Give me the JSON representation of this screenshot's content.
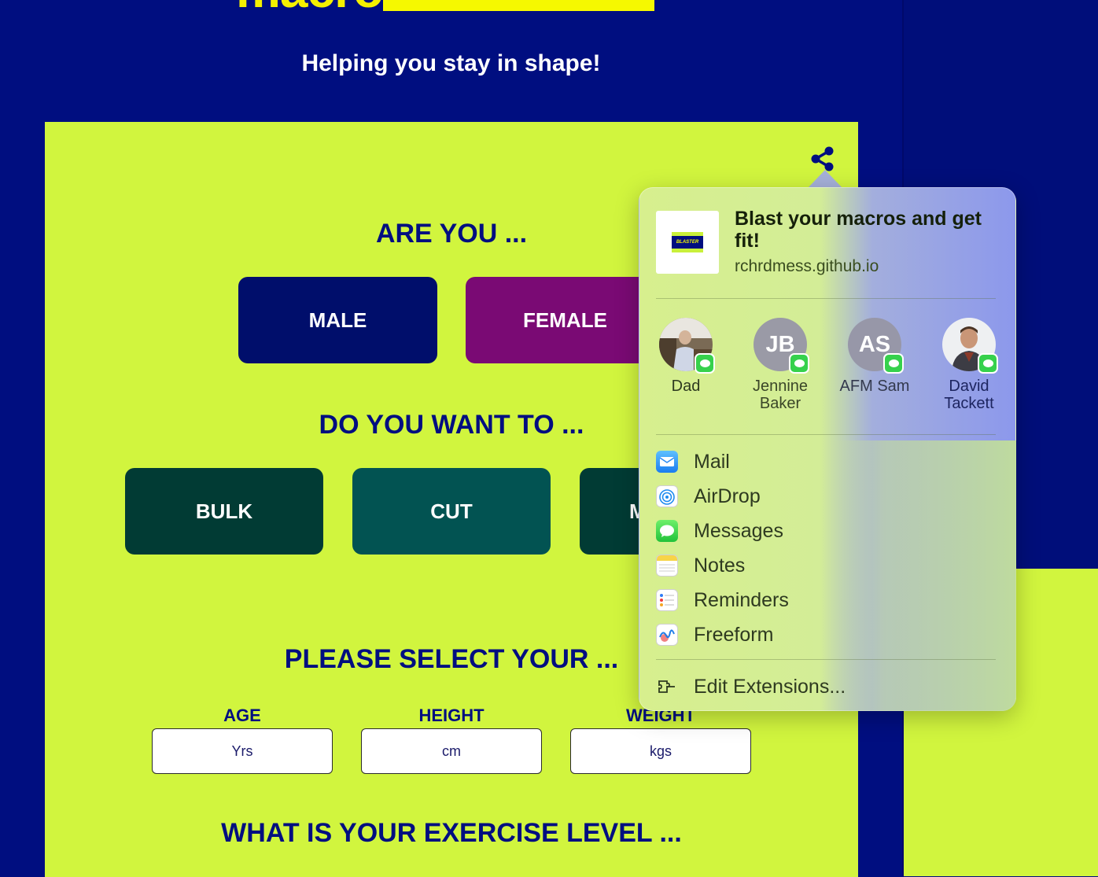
{
  "header": {
    "logo_text": "macro",
    "tagline": "Helping you stay in shape!"
  },
  "form": {
    "gender_heading": "ARE YOU ...",
    "gender_options": [
      "MALE",
      "FEMALE"
    ],
    "goal_heading": "DO YOU WANT TO ...",
    "goal_options": [
      "BULK",
      "CUT",
      "M"
    ],
    "details_heading": "PLEASE SELECT YOUR ...",
    "fields": [
      {
        "label": "AGE",
        "placeholder": "Yrs"
      },
      {
        "label": "HEIGHT",
        "placeholder": "cm"
      },
      {
        "label": "WEIGHT",
        "placeholder": "kgs"
      }
    ],
    "exercise_heading": "WHAT IS YOUR EXERCISE LEVEL ..."
  },
  "share_sheet": {
    "title": "Blast your macros and get fit!",
    "url": "rchrdmess.github.io",
    "thumbnail_text": "BLASTER",
    "contacts": [
      {
        "name": "Dad",
        "initials": ""
      },
      {
        "name": "Jennine Baker",
        "initials": "JB"
      },
      {
        "name": "AFM Sam",
        "initials": "AS"
      },
      {
        "name": "David Tackett",
        "initials": ""
      }
    ],
    "apps": [
      "Mail",
      "AirDrop",
      "Messages",
      "Notes",
      "Reminders",
      "Freeform"
    ],
    "edit_extensions": "Edit Extensions..."
  },
  "colors": {
    "page_bg": "#000e80",
    "card_bg": "#d1f53e",
    "male": "#000e6b",
    "female": "#7a0a74",
    "bulk": "#013b34",
    "cut": "#025352",
    "accent_yellow": "#f6f800"
  }
}
